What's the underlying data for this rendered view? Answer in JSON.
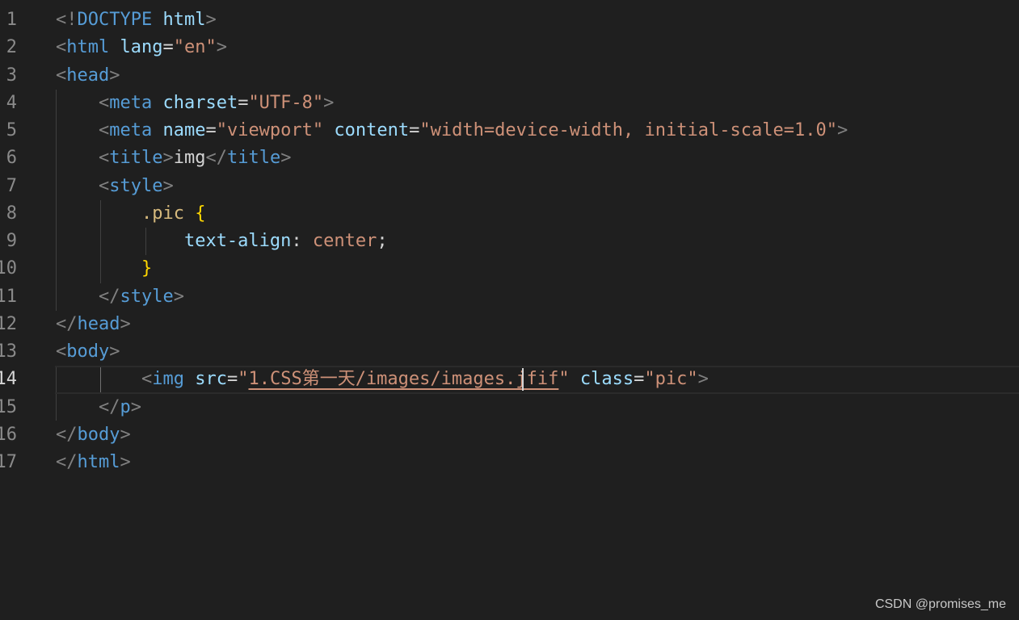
{
  "editor": {
    "language": "html",
    "active_line": 14,
    "lines": [
      {
        "n": "1",
        "tokens": [
          [
            "punc",
            "<"
          ],
          [
            "punc",
            "!"
          ],
          [
            "tag",
            "DOCTYPE"
          ],
          [
            "text",
            " "
          ],
          [
            "attr",
            "html"
          ],
          [
            "punc",
            ">"
          ]
        ]
      },
      {
        "n": "2",
        "tokens": [
          [
            "punc",
            "<"
          ],
          [
            "tag",
            "html"
          ],
          [
            "text",
            " "
          ],
          [
            "attr",
            "lang"
          ],
          [
            "eq",
            "="
          ],
          [
            "str",
            "\"en\""
          ],
          [
            "punc",
            ">"
          ]
        ]
      },
      {
        "n": "3",
        "tokens": [
          [
            "punc",
            "<"
          ],
          [
            "tag",
            "head"
          ],
          [
            "punc",
            ">"
          ]
        ]
      },
      {
        "n": "4",
        "tokens": [
          [
            "text",
            "    "
          ],
          [
            "punc",
            "<"
          ],
          [
            "tag",
            "meta"
          ],
          [
            "text",
            " "
          ],
          [
            "attr",
            "charset"
          ],
          [
            "eq",
            "="
          ],
          [
            "str",
            "\"UTF-8\""
          ],
          [
            "punc",
            ">"
          ]
        ]
      },
      {
        "n": "5",
        "tokens": [
          [
            "text",
            "    "
          ],
          [
            "punc",
            "<"
          ],
          [
            "tag",
            "meta"
          ],
          [
            "text",
            " "
          ],
          [
            "attr",
            "name"
          ],
          [
            "eq",
            "="
          ],
          [
            "str",
            "\"viewport\""
          ],
          [
            "text",
            " "
          ],
          [
            "attr",
            "content"
          ],
          [
            "eq",
            "="
          ],
          [
            "str",
            "\"width=device-width, initial-scale=1.0\""
          ],
          [
            "punc",
            ">"
          ]
        ]
      },
      {
        "n": "6",
        "tokens": [
          [
            "text",
            "    "
          ],
          [
            "punc",
            "<"
          ],
          [
            "tag",
            "title"
          ],
          [
            "punc",
            ">"
          ],
          [
            "text",
            "img"
          ],
          [
            "punc",
            "</"
          ],
          [
            "tag",
            "title"
          ],
          [
            "punc",
            ">"
          ]
        ]
      },
      {
        "n": "7",
        "tokens": [
          [
            "text",
            "    "
          ],
          [
            "punc",
            "<"
          ],
          [
            "tag",
            "style"
          ],
          [
            "punc",
            ">"
          ]
        ]
      },
      {
        "n": "8",
        "tokens": [
          [
            "text",
            "        "
          ],
          [
            "sel",
            ".pic"
          ],
          [
            "text",
            " "
          ],
          [
            "brace",
            "{"
          ]
        ]
      },
      {
        "n": "9",
        "tokens": [
          [
            "text",
            "            "
          ],
          [
            "prop",
            "text-align"
          ],
          [
            "text",
            ": "
          ],
          [
            "val",
            "center"
          ],
          [
            "text",
            ";"
          ]
        ]
      },
      {
        "n": "10",
        "tokens": [
          [
            "text",
            "        "
          ],
          [
            "brace",
            "}"
          ]
        ]
      },
      {
        "n": "11",
        "tokens": [
          [
            "text",
            "    "
          ],
          [
            "punc",
            "</"
          ],
          [
            "tag",
            "style"
          ],
          [
            "punc",
            ">"
          ]
        ]
      },
      {
        "n": "12",
        "tokens": [
          [
            "punc",
            "</"
          ],
          [
            "tag",
            "head"
          ],
          [
            "punc",
            ">"
          ]
        ]
      },
      {
        "n": "13",
        "tokens": [
          [
            "punc",
            "<"
          ],
          [
            "tag",
            "body"
          ],
          [
            "punc",
            ">"
          ]
        ]
      },
      {
        "n": "14",
        "tokens": [
          [
            "text",
            "        "
          ],
          [
            "punc",
            "<"
          ],
          [
            "tag",
            "img"
          ],
          [
            "text",
            " "
          ],
          [
            "attr",
            "src"
          ],
          [
            "eq",
            "="
          ],
          [
            "str",
            "\""
          ],
          [
            "url",
            "1.CSS第一天/images/images.jfif"
          ],
          [
            "str",
            "\""
          ],
          [
            "text",
            " "
          ],
          [
            "attr",
            "class"
          ],
          [
            "eq",
            "="
          ],
          [
            "str",
            "\"pic\""
          ],
          [
            "punc",
            ">"
          ]
        ]
      },
      {
        "n": "15",
        "tokens": [
          [
            "text",
            "    "
          ],
          [
            "punc",
            "</"
          ],
          [
            "tag",
            "p"
          ],
          [
            "punc",
            ">"
          ]
        ]
      },
      {
        "n": "16",
        "tokens": [
          [
            "punc",
            "</"
          ],
          [
            "tag",
            "body"
          ],
          [
            "punc",
            ">"
          ]
        ]
      },
      {
        "n": "17",
        "tokens": [
          [
            "punc",
            "</"
          ],
          [
            "tag",
            "html"
          ],
          [
            "punc",
            ">"
          ]
        ]
      }
    ]
  },
  "watermark": "CSDN @promises_me",
  "colors": {
    "background": "#1f1f1f",
    "tag": "#569cd6",
    "attribute": "#9cdcfe",
    "string": "#ce9178",
    "selector": "#d7ba7d",
    "brace": "#ffd700",
    "line_number": "#8a8a8a"
  }
}
